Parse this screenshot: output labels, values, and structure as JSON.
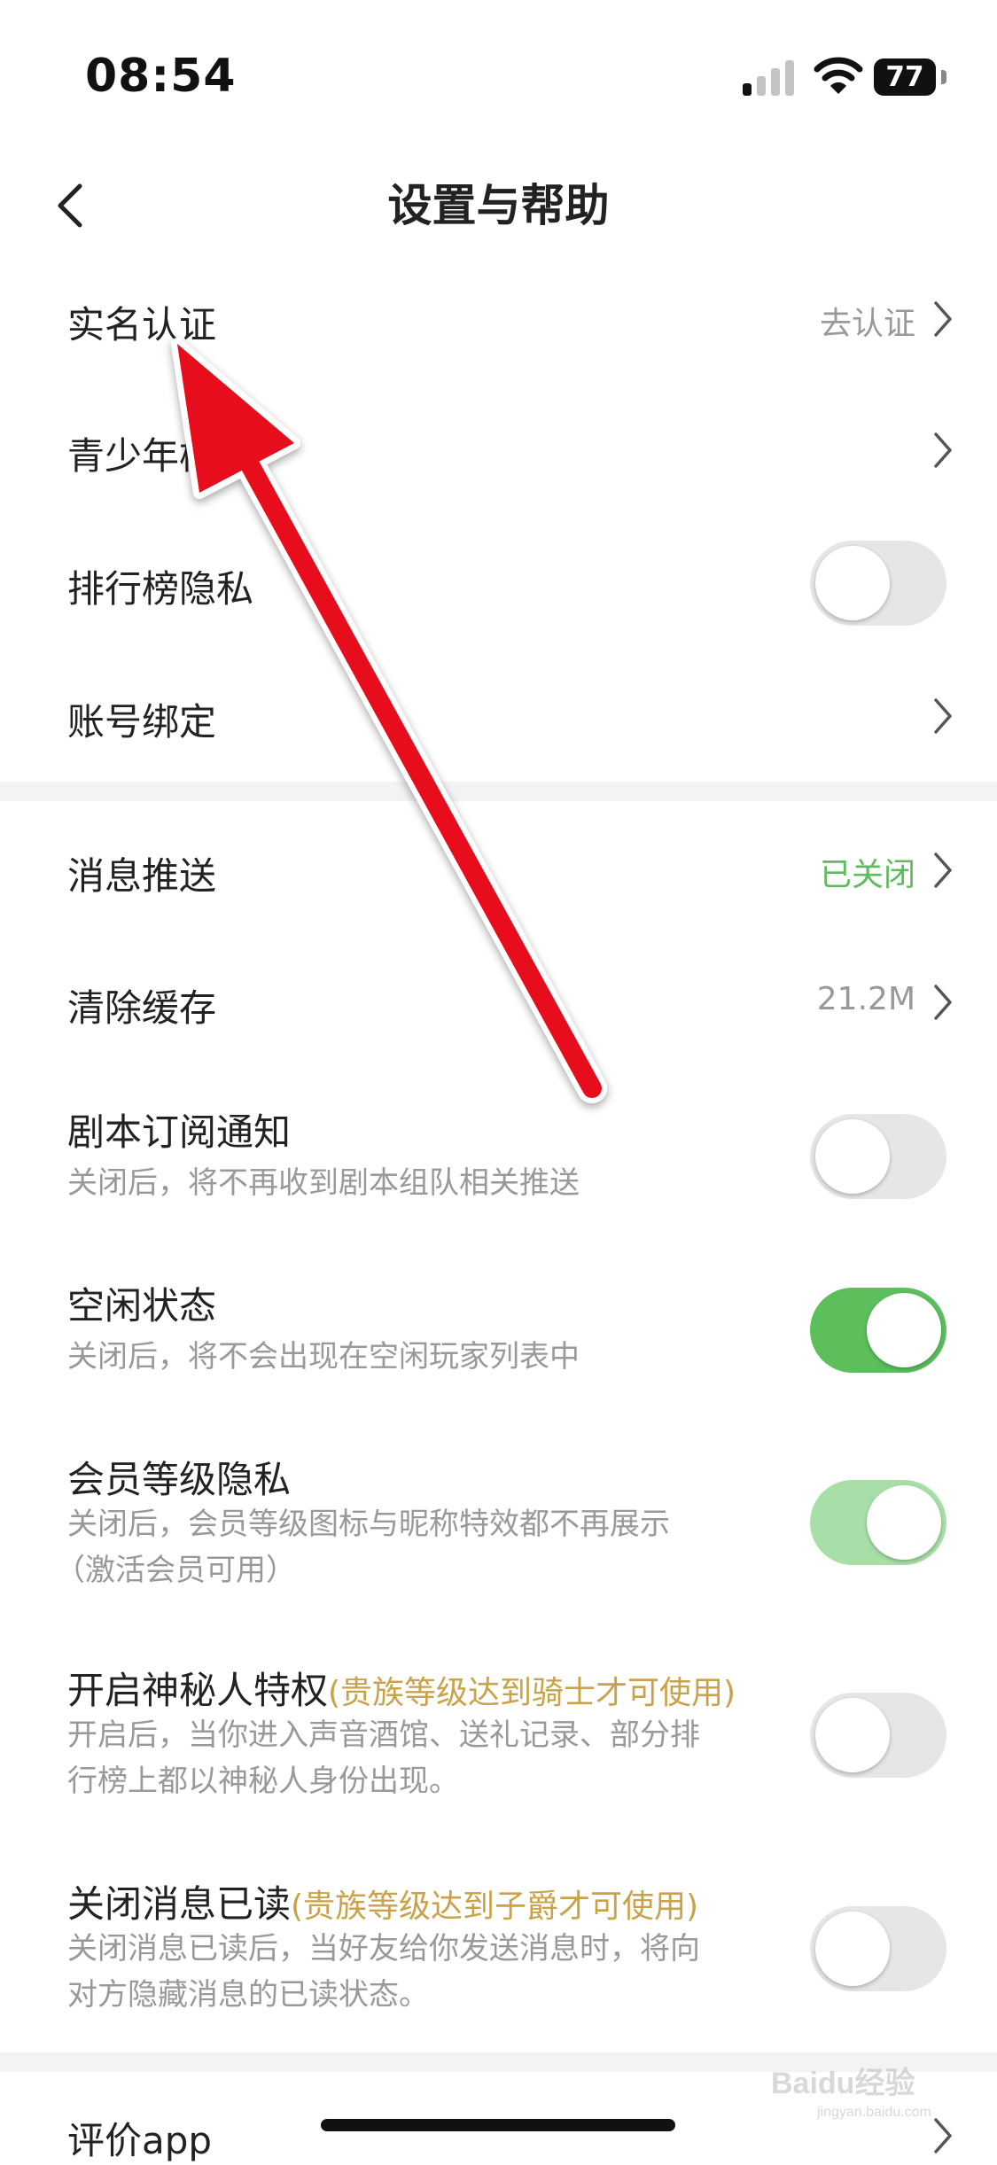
{
  "status_bar": {
    "time": "08:54",
    "battery": "77"
  },
  "nav": {
    "title": "设置与帮助"
  },
  "section1": [
    {
      "label": "实名认证",
      "value": "去认证",
      "control": "chevron"
    },
    {
      "label": "青少年模式",
      "control": "chevron"
    },
    {
      "label": "排行榜隐私",
      "control": "toggle",
      "state": "off"
    },
    {
      "label": "账号绑定",
      "control": "chevron"
    }
  ],
  "section2": [
    {
      "label": "消息推送",
      "value": "已关闭",
      "value_color": "#5fbb5f",
      "control": "chevron"
    },
    {
      "label": "清除缓存",
      "value": "21.2M",
      "control": "chevron"
    },
    {
      "label": "剧本订阅通知",
      "sub": "关闭后，将不再收到剧本组队相关推送",
      "control": "toggle",
      "state": "off"
    },
    {
      "label": "空闲状态",
      "sub": "关闭后，将不会出现在空闲玩家列表中",
      "control": "toggle",
      "state": "on"
    },
    {
      "label": "会员等级隐私",
      "sub_lines": [
        "关闭后，会员等级图标与昵称特效都不再展示",
        "（激活会员可用）"
      ],
      "control": "toggle",
      "state": "on-disabled"
    },
    {
      "label": "开启神秘人特权",
      "note": "(贵族等级达到骑士才可使用)",
      "sub_lines": [
        "开启后，当你进入声音酒馆、送礼记录、部分排",
        "行榜上都以神秘人身份出现。"
      ],
      "control": "toggle",
      "state": "off"
    },
    {
      "label": "关闭消息已读",
      "note": "(贵族等级达到子爵才可使用)",
      "sub_lines": [
        "关闭消息已读后，当好友给你发送消息时，将向",
        "对方隐藏消息的已读状态。"
      ],
      "control": "toggle",
      "state": "off"
    }
  ],
  "section3": [
    {
      "label": "评价app",
      "control": "chevron"
    }
  ],
  "colors": {
    "accent_green": "#5cbf5c",
    "gold_note": "#c9a24a",
    "annotation_arrow": "#e8101c"
  },
  "watermark": {
    "text": "Baidu经验",
    "sub": "jingyan.baidu.com"
  }
}
